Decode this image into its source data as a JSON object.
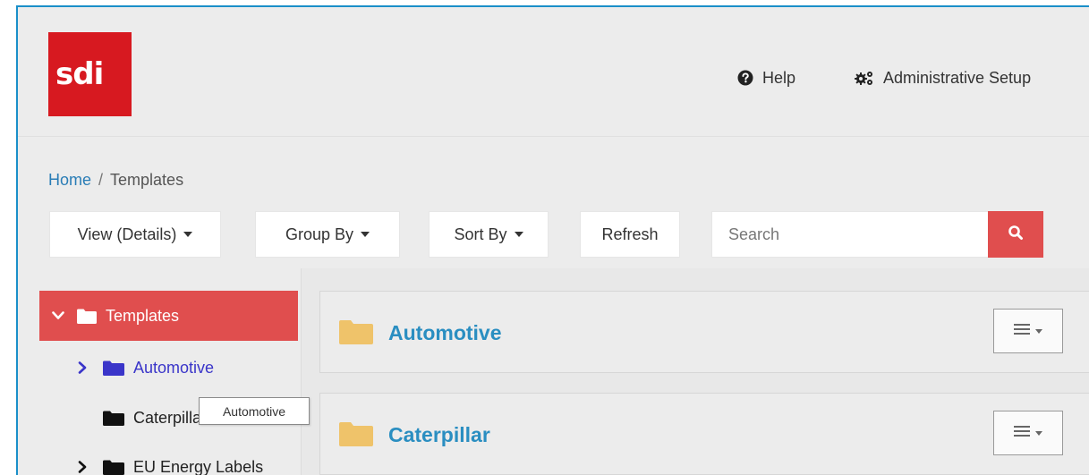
{
  "header": {
    "logo_text": "sdi",
    "help_label": "Help",
    "admin_label": "Administrative Setup"
  },
  "breadcrumb": {
    "home": "Home",
    "separator": "/",
    "current": "Templates"
  },
  "toolbar": {
    "view_label": "View (Details)",
    "group_label": "Group By",
    "sort_label": "Sort By",
    "refresh_label": "Refresh",
    "search_placeholder": "Search"
  },
  "tree": {
    "root": "Templates",
    "items": [
      {
        "label": "Automotive",
        "expandable": true,
        "folder_color": "#3a35c9"
      },
      {
        "label": "Caterpillar",
        "expandable": false,
        "folder_color": "#111111"
      },
      {
        "label": "EU Energy Labels",
        "expandable": true,
        "folder_color": "#111111"
      }
    ]
  },
  "tooltip": "Automotive",
  "folders": [
    {
      "title": "Automotive"
    },
    {
      "title": "Caterpillar"
    }
  ],
  "colors": {
    "brand_red": "#d71920",
    "accent_red": "#e04e4e",
    "link_blue": "#2a8ec1",
    "frame_blue": "#1a8fc9",
    "folder_yellow": "#efc36a"
  }
}
